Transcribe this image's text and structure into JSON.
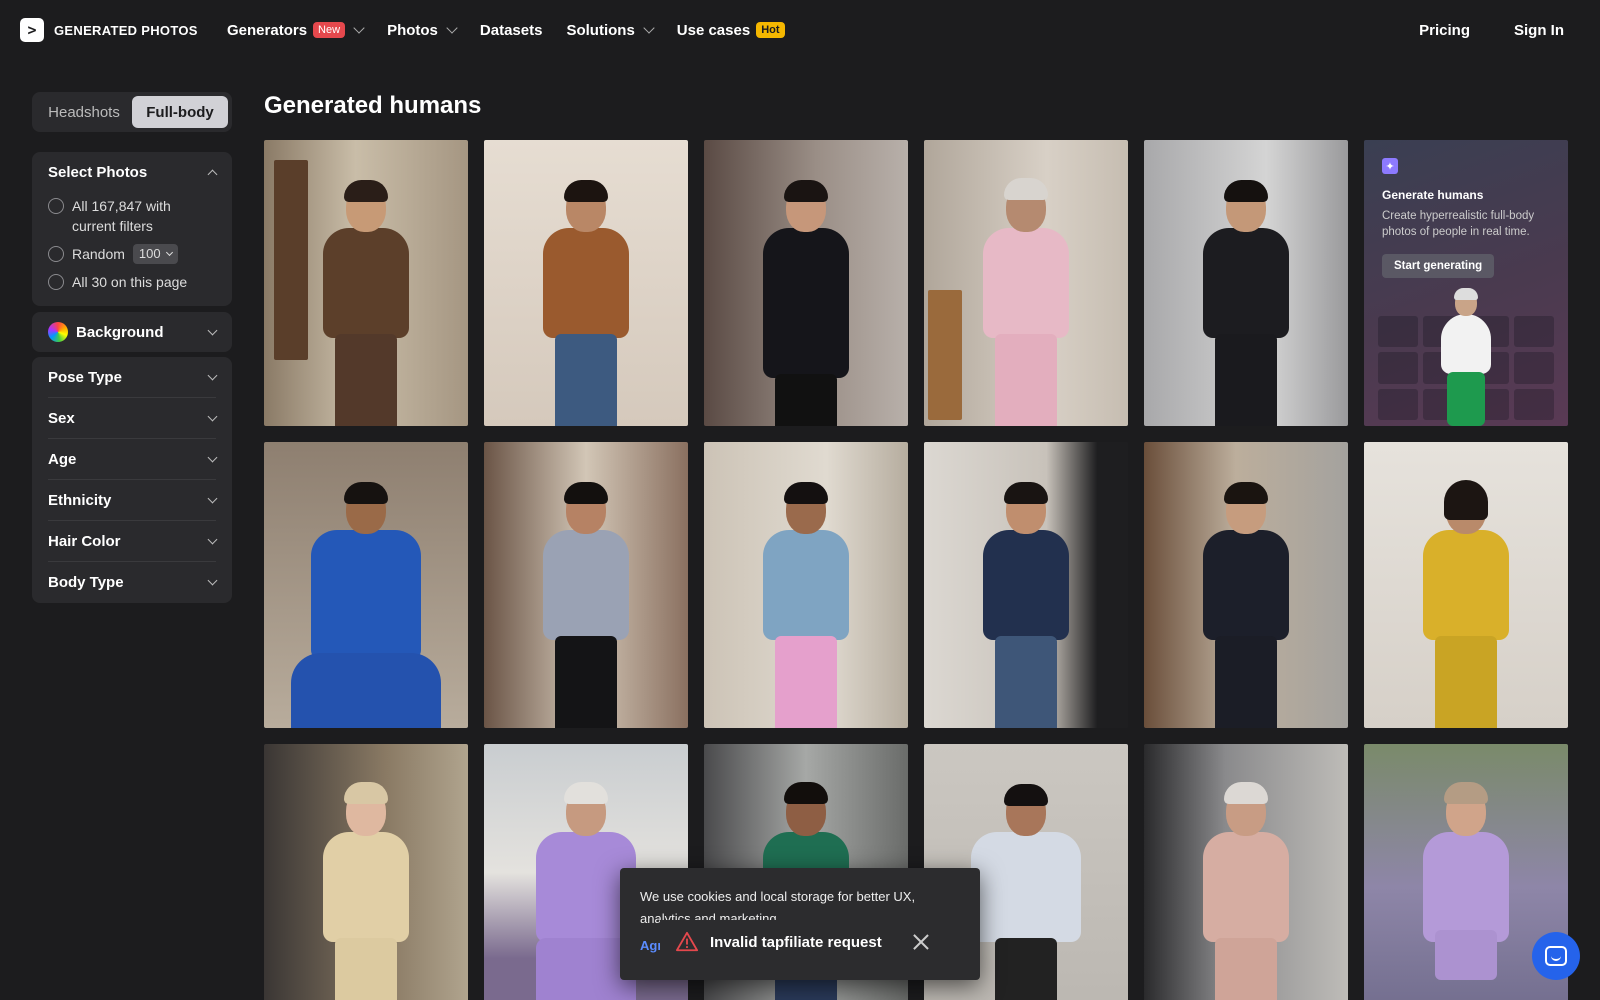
{
  "header": {
    "logo_text": "GENERATED PHOTOS",
    "logo_glyph": ">",
    "nav": [
      {
        "label": "Generators",
        "badge": "New"
      },
      {
        "label": "Photos"
      },
      {
        "label": "Datasets"
      },
      {
        "label": "Solutions"
      },
      {
        "label": "Use cases",
        "badge": "Hot"
      }
    ],
    "pricing": "Pricing",
    "signin": "Sign In"
  },
  "sidebar": {
    "toggle": [
      "Headshots",
      "Full-body"
    ],
    "select_photos": {
      "title": "Select Photos",
      "all_filters": "All 167,847 with current filters",
      "random_label": "Random",
      "random_value": "100",
      "all_page": "All 30 on this page"
    },
    "background": "Background",
    "filters": [
      "Pose Type",
      "Sex",
      "Age",
      "Ethnicity",
      "Hair Color",
      "Body Type"
    ]
  },
  "main": {
    "title": "Generated humans",
    "promo": {
      "title": "Generate humans",
      "text": "Create hyperrealistic full-body photos of people in real time.",
      "button": "Start generating"
    }
  },
  "cookie": {
    "text": "We use cookies and local storage for better UX, analytics and marketing.",
    "agree": "Agree"
  },
  "toast": {
    "text": "Invalid tapfiliate request"
  },
  "colors": {
    "background": "#1c1c1e",
    "panel": "#2a2a2d",
    "accent_blue": "#2563eb",
    "badge_new": "#e5484d",
    "badge_hot": "#f5b700"
  }
}
